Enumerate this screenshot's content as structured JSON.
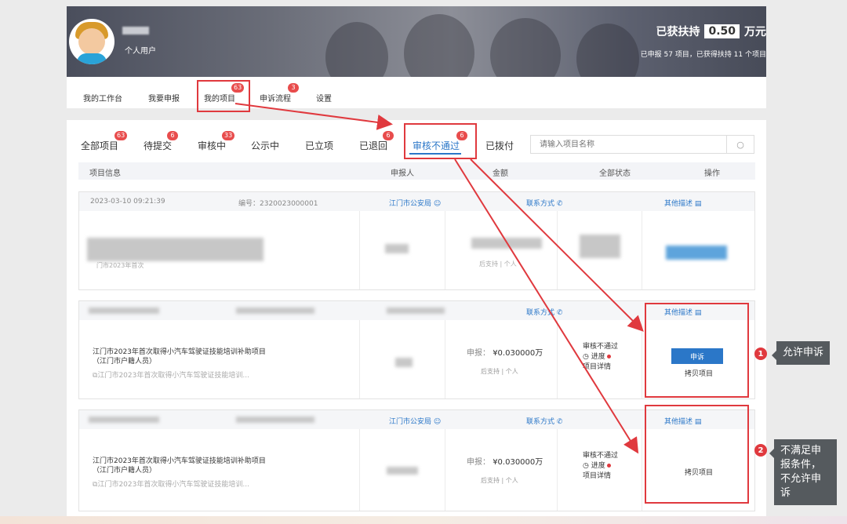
{
  "header": {
    "user_type": "个人用户",
    "support_label": "已获扶持",
    "support_amount": "0.50",
    "support_unit": "万元",
    "support_sub": "已申报 57 项目，已获得扶持 11 个项目"
  },
  "nav": {
    "items": [
      {
        "label": "我的工作台"
      },
      {
        "label": "我要申报"
      },
      {
        "label": "我的项目",
        "badge": "63"
      },
      {
        "label": "申诉流程",
        "badge": "3"
      },
      {
        "label": "设置"
      }
    ]
  },
  "tabs": [
    {
      "label": "全部项目",
      "badge": "63"
    },
    {
      "label": "待提交",
      "badge": "6"
    },
    {
      "label": "审核中",
      "badge": "33"
    },
    {
      "label": "公示中"
    },
    {
      "label": "已立项"
    },
    {
      "label": "已退回",
      "badge": "6"
    },
    {
      "label": "审核不通过",
      "badge": "6"
    },
    {
      "label": "已拨付"
    }
  ],
  "search": {
    "placeholder": "请输入项目名称"
  },
  "table_headers": [
    "项目信息",
    "申报人",
    "金额",
    "全部状态",
    "操作"
  ],
  "rows": [
    {
      "date": "2023-03-10 09:21:39",
      "code": "编号：2320023000001",
      "applicant": "江门市公安局",
      "contact": "联系方式",
      "other": "其他描述",
      "sub_fragment": "门市2023年首次",
      "after_fragment": "后支持 | 个人"
    },
    {
      "contact": "联系方式",
      "other": "其他描述",
      "title": "江门市2023年首次取得小汽车驾驶证技能培训补助项目（江门市户籍人员）",
      "sub": "江门市2023年首次取得小汽车驾驶证技能培训...",
      "amount_label": "申报：",
      "amount": "¥0.030000万",
      "after": "后支持 | 个人",
      "status": "审核不通过",
      "progress": "进度",
      "detail": "项目详情",
      "appeal": "申诉",
      "copy": "拷贝项目"
    },
    {
      "applicant": "江门市公安局",
      "contact": "联系方式",
      "other": "其他描述",
      "title": "江门市2023年首次取得小汽车驾驶证技能培训补助项目（江门市户籍人员）",
      "sub": "江门市2023年首次取得小汽车驾驶证技能培训...",
      "amount_label": "申报：",
      "amount": "¥0.030000万",
      "after": "后支持 | 个人",
      "status": "审核不通过",
      "progress": "进度",
      "detail": "项目详情",
      "copy": "拷贝项目"
    }
  ],
  "callouts": [
    {
      "num": "1",
      "text": "允许申诉"
    },
    {
      "num": "2",
      "text": "不满足申报条件，不允许申诉"
    }
  ],
  "colors": {
    "accent": "#2b77c8",
    "annotation_red": "#e0393e",
    "badge": "#e84c4c"
  }
}
